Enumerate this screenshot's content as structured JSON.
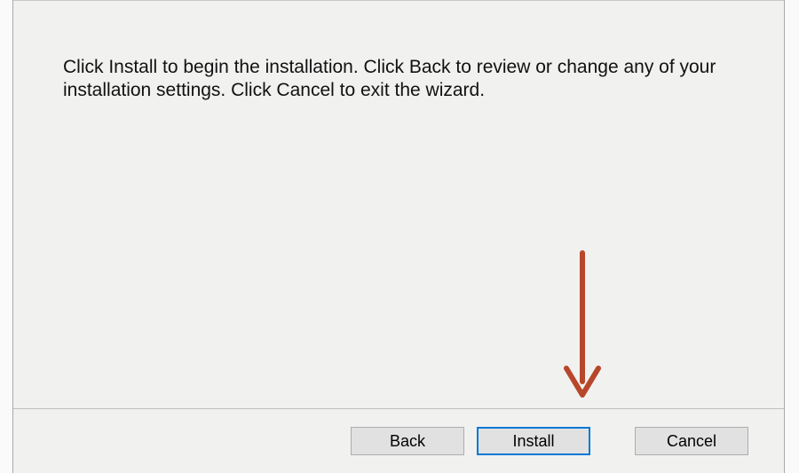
{
  "content": {
    "instructions": "Click Install to begin the installation. Click Back to review or change any of your installation settings. Click Cancel to exit the wizard."
  },
  "buttons": {
    "back": "Back",
    "install": "Install",
    "cancel": "Cancel"
  },
  "annotation": {
    "arrow_color": "#b7472a"
  }
}
